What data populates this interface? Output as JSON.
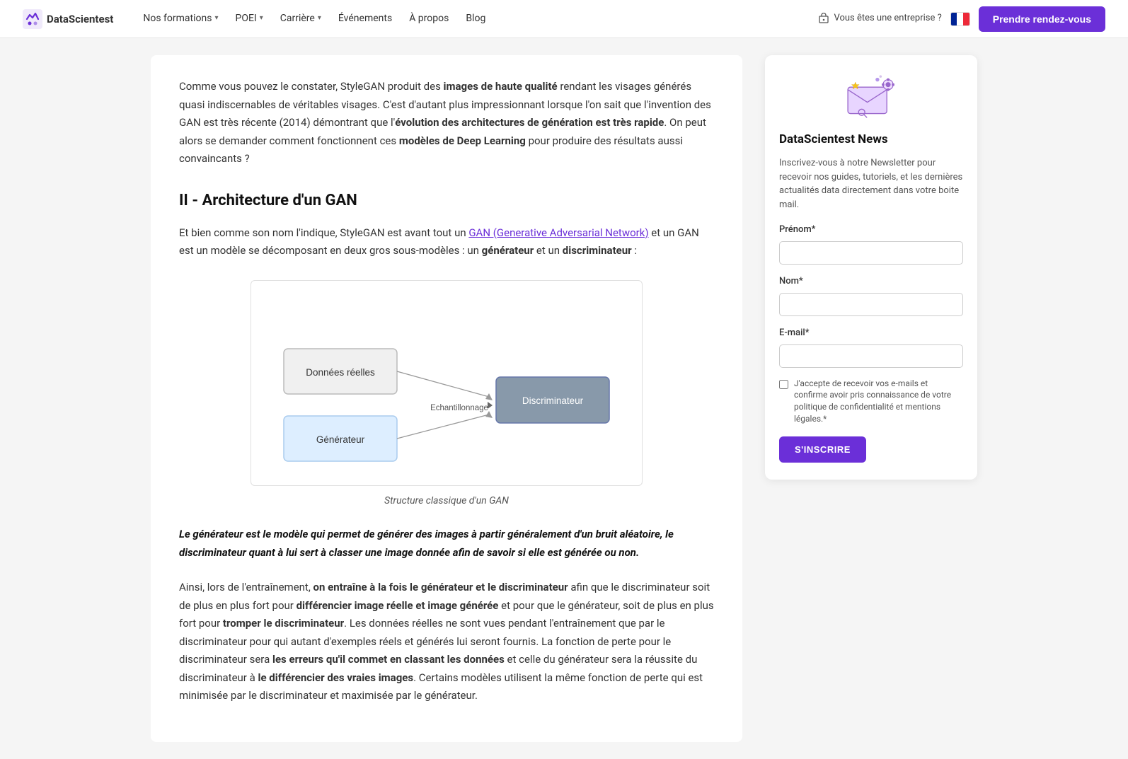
{
  "brand": {
    "name": "DataScientest",
    "logo_text": "DataScientest"
  },
  "nav": {
    "formations_label": "Nos formations",
    "formations_chevron": "▾",
    "poei_label": "POEI",
    "poei_chevron": "▾",
    "carriere_label": "Carrière",
    "carriere_chevron": "▾",
    "evenements_label": "Événements",
    "apropos_label": "À propos",
    "blog_label": "Blog",
    "enterprise_label": "Vous êtes une entreprise ?",
    "cta_label": "Prendre rendez-vous"
  },
  "content": {
    "para1": "Comme vous pouvez le constater, StyleGAN produit des images de haute qualité rendant les visages générés quasi indiscernables de véritables visages. C'est d'autant plus impressionnant lorsque l'on sait que l'invention des GAN est très récente (2014) démontrant que l'évolution des architectures de génération est très rapide. On peut alors se demander comment fonctionnent ces modèles de Deep Learning pour produire des résultats aussi convaincants ?",
    "para1_bold1": "images de haute qualité",
    "para1_bold2": "évolution des architectures de génération est très rapide",
    "para1_bold3": "modèles de Deep Learning",
    "section_heading": "II - Architecture d'un GAN",
    "para2_prefix": "Et bien comme son nom l'indique, StyleGAN est avant tout un ",
    "para2_link": "GAN (Generative Adversarial Network)",
    "para2_suffix": " et un GAN est un modèle se décomposant en deux gros sous-modèles : un ",
    "para2_bold1": "générateur",
    "para2_mid": " et un ",
    "para2_bold2": "discriminateur",
    "para2_end": " :",
    "diagram_caption": "Structure classique d'un GAN",
    "diagram_node_donnees": "Données réelles",
    "diagram_node_generateur": "Générateur",
    "diagram_node_discriminateur": "Discriminateur",
    "diagram_label_echantillonnage": "Echantillonnage",
    "italic_bold_text": "Le générateur est le modèle qui permet de générer des images à partir généralement d'un bruit aléatoire, le discriminateur quant à lui sert à classer une image donnée afin de savoir si elle est générée ou non.",
    "para3": "Ainsi, lors de l'entraînement, on entraîne à la fois le générateur et le discriminateur afin que le discriminateur soit de plus en plus fort pour différencier image réelle et image générée et pour que le générateur, soit de plus en plus fort pour tromper le discriminateur. Les données réelles ne sont vues pendant l'entraînement que par le discriminateur pour qui autant d'exemples réels et générés lui seront fournis. La fonction de perte pour le discriminateur sera les erreurs qu'il commet en classant les données et celle du générateur sera la réussite du discriminateur à le différencier des vraies images. Certains modèles utilisent la même fonction de perte qui est minimisée par le discriminateur et maximisée par le générateur.",
    "para3_bold1": "on entraîne à la fois le générateur et le discriminateur",
    "para3_bold2": "différencier image réelle et image générée",
    "para3_bold3": "tromper le discriminateur",
    "para3_bold4": "les erreurs qu'il commet en classant les données",
    "para3_bold5": "le différencier des vraies images"
  },
  "newsletter": {
    "title": "DataScientest News",
    "desc": "Inscrivez-vous à notre Newsletter pour recevoir nos guides, tutoriels, et les dernières actualités data directement dans votre boite mail.",
    "prenom_label": "Prénom*",
    "prenom_placeholder": "",
    "nom_label": "Nom*",
    "nom_placeholder": "",
    "email_label": "E-mail*",
    "email_placeholder": "",
    "checkbox_label": "J'accepte de recevoir vos e-mails et confirme avoir pris connaissance de votre politique de confidentialité et mentions légales.*",
    "subscribe_btn": "S'INSCRIRE"
  }
}
